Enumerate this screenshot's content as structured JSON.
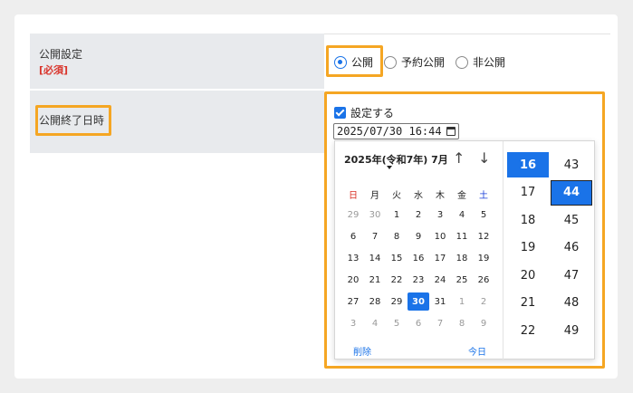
{
  "publish": {
    "label": "公開設定",
    "required": "[必須]",
    "options": [
      "公開",
      "予約公開",
      "非公開"
    ]
  },
  "end": {
    "label": "公開終了日時",
    "checkbox": "設定する",
    "value": "2025/07/30 16:44"
  },
  "calendar": {
    "month_title": "2025年(令和7年) 7月",
    "weekdays": [
      "日",
      "月",
      "火",
      "水",
      "木",
      "金",
      "土"
    ],
    "weeks": [
      [
        "29",
        "30",
        "1",
        "2",
        "3",
        "4",
        "5"
      ],
      [
        "6",
        "7",
        "8",
        "9",
        "10",
        "11",
        "12"
      ],
      [
        "13",
        "14",
        "15",
        "16",
        "17",
        "18",
        "19"
      ],
      [
        "20",
        "21",
        "22",
        "23",
        "24",
        "25",
        "26"
      ],
      [
        "27",
        "28",
        "29",
        "30",
        "31",
        "1",
        "2"
      ],
      [
        "3",
        "4",
        "5",
        "6",
        "7",
        "8",
        "9"
      ]
    ],
    "clear": "削除",
    "today": "今日"
  },
  "time": {
    "hours": [
      "16",
      "17",
      "18",
      "19",
      "20",
      "21",
      "22"
    ],
    "minutes": [
      "43",
      "44",
      "45",
      "46",
      "47",
      "48",
      "49"
    ]
  },
  "colors": {
    "accent": "#1a73e8",
    "highlight": "#f5a623",
    "sunday": "#d93025",
    "saturday": "#1a3fd8"
  }
}
